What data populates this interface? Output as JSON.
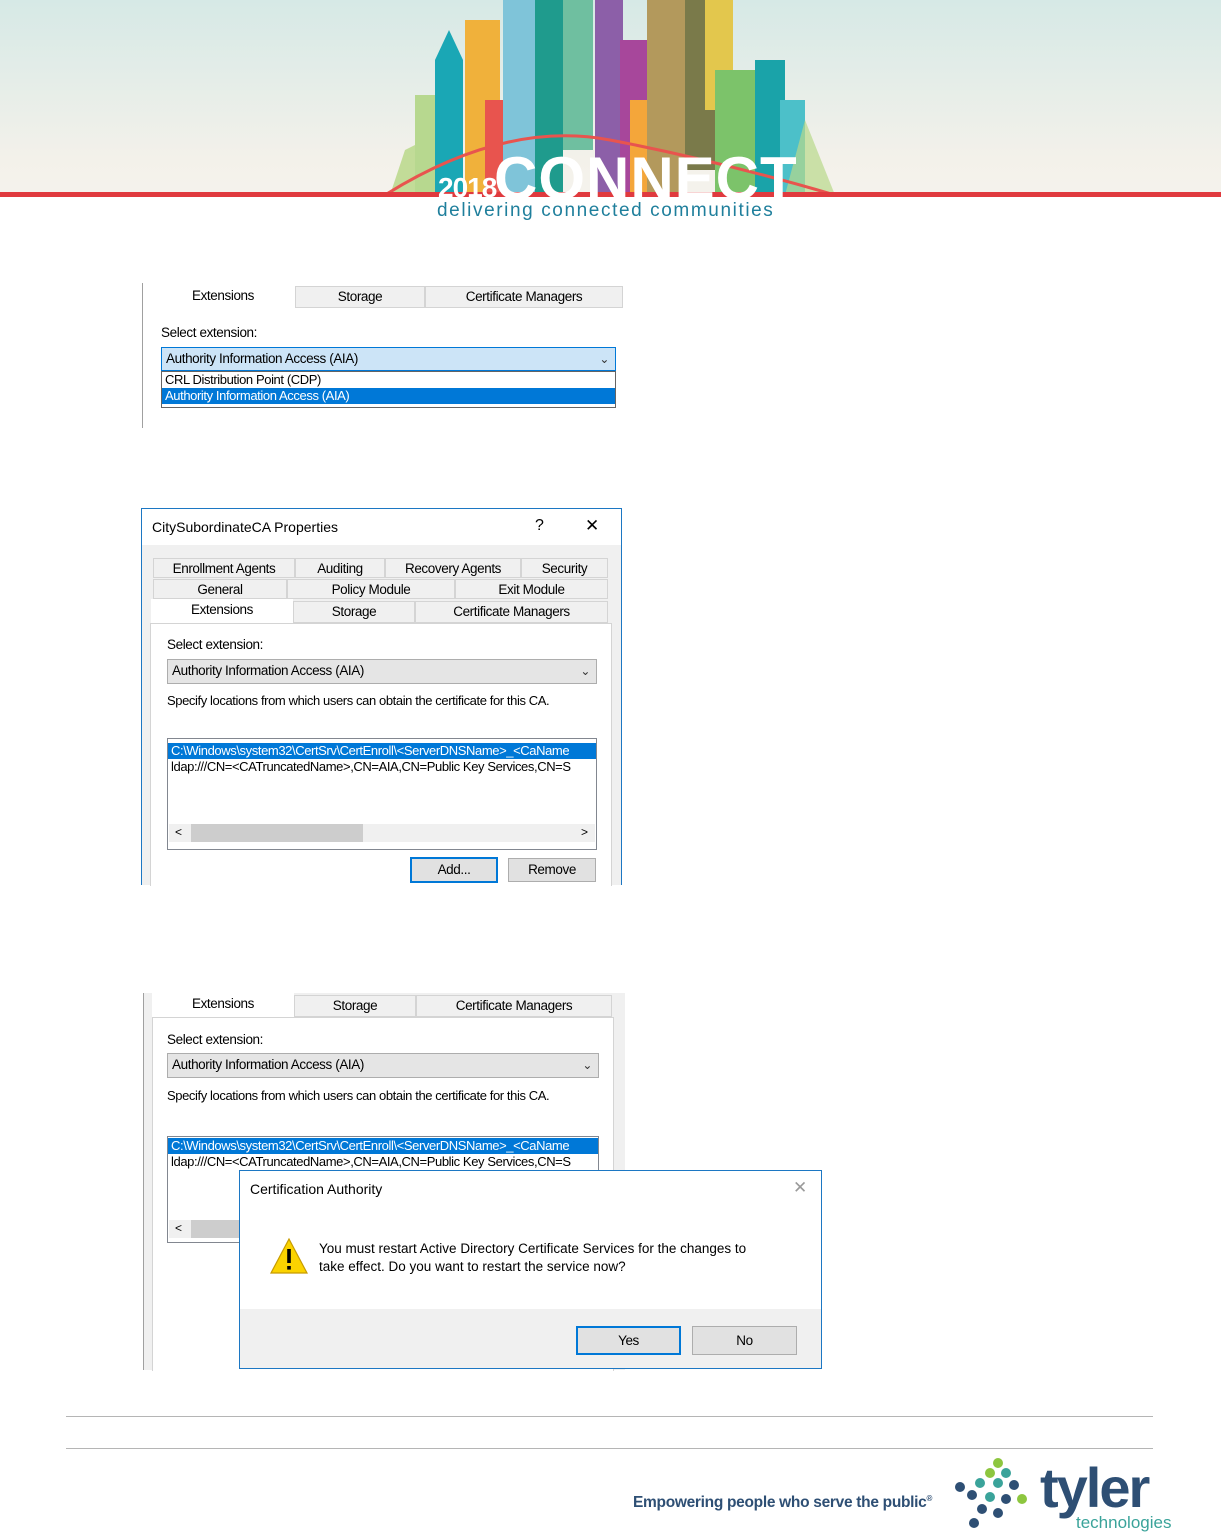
{
  "header": {
    "year": "2018",
    "conference_name": "CONNECT",
    "tagline": "delivering connected communities"
  },
  "shot1": {
    "tabs": [
      "Extensions",
      "Storage",
      "Certificate Managers"
    ],
    "select_label": "Select extension:",
    "combo_value": "Authority Information Access (AIA)",
    "options": [
      "CRL Distribution Point (CDP)",
      "Authority Information Access (AIA)"
    ]
  },
  "shot2": {
    "title": "CitySubordinateCA Properties",
    "help": "?",
    "close": "✕",
    "tab_row1": [
      "Enrollment Agents",
      "Auditing",
      "Recovery Agents",
      "Security"
    ],
    "tab_row2": [
      "General",
      "Policy Module",
      "Exit Module"
    ],
    "tab_row3": [
      "Extensions",
      "Storage",
      "Certificate Managers"
    ],
    "select_label": "Select extension:",
    "combo_value": "Authority Information Access (AIA)",
    "desc": "Specify locations from which users can obtain the certificate for this CA.",
    "locations": [
      "C:\\Windows\\system32\\CertSrv\\CertEnroll\\<ServerDNSName>_<CaName",
      "ldap:///CN=<CATruncatedName>,CN=AIA,CN=Public Key Services,CN=S"
    ],
    "add_label": "Add...",
    "remove_label": "Remove"
  },
  "shot3": {
    "tabs": [
      "Extensions",
      "Storage",
      "Certificate Managers"
    ],
    "select_label": "Select extension:",
    "combo_value": "Authority Information Access (AIA)",
    "desc": "Specify locations from which users can obtain the certificate for this CA.",
    "locations": [
      "C:\\Windows\\system32\\CertSrv\\CertEnroll\\<ServerDNSName>_<CaName",
      "ldap:///CN=<CATruncatedName>,CN=AIA,CN=Public Key Services,CN=S"
    ],
    "dialog": {
      "title": "Certification Authority",
      "message_line1": "You must restart Active Directory Certificate Services for the changes to",
      "message_line2": "take effect. Do you want to restart the service now?",
      "yes_label": "Yes",
      "no_label": "No"
    }
  },
  "footer": {
    "slogan": "Empowering people who serve the public",
    "brand": "tyler",
    "brand_sub": "technologies"
  },
  "colors": {
    "accent": "#0078d7",
    "brand_blue": "#2e4f74",
    "brand_green": "#3aa39a",
    "header_red": "#e03a3e"
  }
}
